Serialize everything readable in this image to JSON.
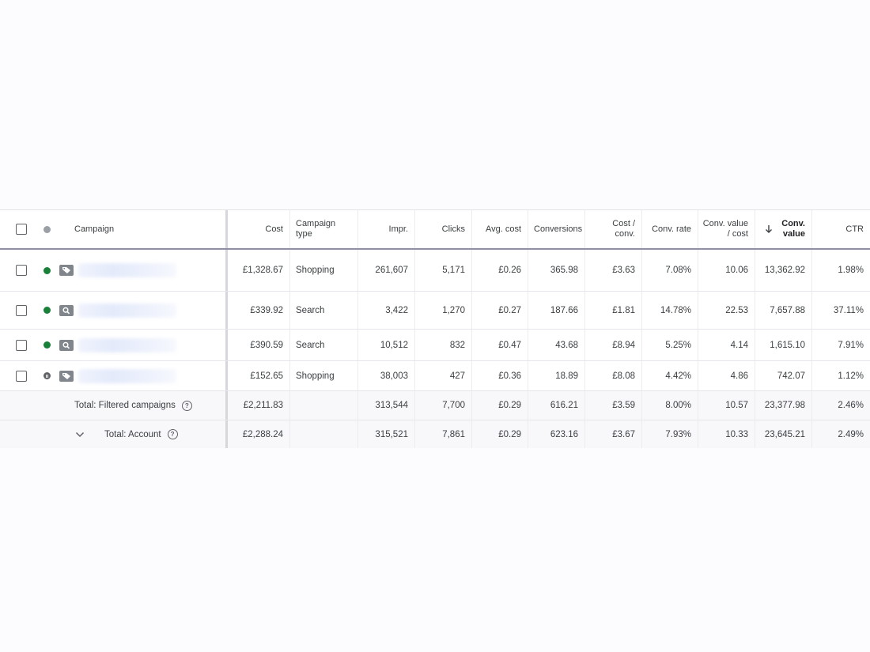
{
  "columns": {
    "campaign": "Campaign",
    "cost": "Cost",
    "campaign_type_1": "Campaign",
    "campaign_type_2": "type",
    "impr": "Impr.",
    "clicks": "Clicks",
    "avg_cost": "Avg. cost",
    "conversions": "Conversions",
    "cost_conv_1": "Cost /",
    "cost_conv_2": "conv.",
    "conv_rate": "Conv. rate",
    "conv_value_cost_1": "Conv. value",
    "conv_value_cost_2": "/ cost",
    "conv_value_1": "Conv.",
    "conv_value_2": "value",
    "ctr": "CTR"
  },
  "rows": [
    {
      "status": "enabled",
      "type_icon": "tag-icon",
      "cost": "£1,328.67",
      "type": "Shopping",
      "impr": "261,607",
      "clicks": "5,171",
      "avg_cost": "£0.26",
      "conversions": "365.98",
      "cost_conv": "£3.63",
      "conv_rate": "7.08%",
      "conv_value_cost": "10.06",
      "conv_value": "13,362.92",
      "ctr": "1.98%"
    },
    {
      "status": "enabled",
      "type_icon": "search-icon",
      "cost": "£339.92",
      "type": "Search",
      "impr": "3,422",
      "clicks": "1,270",
      "avg_cost": "£0.27",
      "conversions": "187.66",
      "cost_conv": "£1.81",
      "conv_rate": "14.78%",
      "conv_value_cost": "22.53",
      "conv_value": "7,657.88",
      "ctr": "37.11%"
    },
    {
      "status": "enabled",
      "type_icon": "search-icon",
      "cost": "£390.59",
      "type": "Search",
      "impr": "10,512",
      "clicks": "832",
      "avg_cost": "£0.47",
      "conversions": "43.68",
      "cost_conv": "£8.94",
      "conv_rate": "5.25%",
      "conv_value_cost": "4.14",
      "conv_value": "1,615.10",
      "ctr": "7.91%"
    },
    {
      "status": "paused",
      "type_icon": "tag-icon",
      "cost": "£152.65",
      "type": "Shopping",
      "impr": "38,003",
      "clicks": "427",
      "avg_cost": "£0.36",
      "conversions": "18.89",
      "cost_conv": "£8.08",
      "conv_rate": "4.42%",
      "conv_value_cost": "4.86",
      "conv_value": "742.07",
      "ctr": "1.12%"
    }
  ],
  "totals": [
    {
      "label": "Total: Filtered campaigns",
      "cost": "£2,211.83",
      "impr": "313,544",
      "clicks": "7,700",
      "avg_cost": "£0.29",
      "conversions": "616.21",
      "cost_conv": "£3.59",
      "conv_rate": "8.00%",
      "conv_value_cost": "10.57",
      "conv_value": "23,377.98",
      "ctr": "2.46%"
    },
    {
      "label": "Total: Account",
      "cost": "£2,288.24",
      "impr": "315,521",
      "clicks": "7,861",
      "avg_cost": "£0.29",
      "conversions": "623.16",
      "cost_conv": "£3.67",
      "conv_rate": "7.93%",
      "conv_value_cost": "10.33",
      "conv_value": "23,645.21",
      "ctr": "2.49%"
    }
  ],
  "colors": {
    "enabled": "#188038",
    "paused": "#5f6368",
    "header_dot": "#9aa0a6"
  }
}
